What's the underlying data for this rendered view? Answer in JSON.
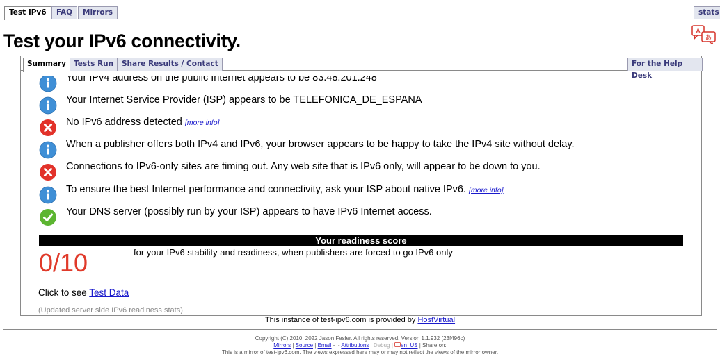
{
  "top_tabs": {
    "test": "Test IPv6",
    "faq": "FAQ",
    "mirrors": "Mirrors",
    "stats": "stats"
  },
  "page_title": "Test your IPv6 connectivity.",
  "inner_tabs": {
    "summary": "Summary",
    "tests_run": "Tests Run",
    "share": "Share Results / Contact",
    "help_desk": "For the Help Desk"
  },
  "results": [
    {
      "status": "info",
      "text": "Your IPv4 address on the public Internet appears to be 83.48.201.248",
      "more": ""
    },
    {
      "status": "info",
      "text": "Your Internet Service Provider (ISP) appears to be TELEFONICA_DE_ESPANA",
      "more": ""
    },
    {
      "status": "error",
      "text": "No IPv6 address detected",
      "more": "[more info]"
    },
    {
      "status": "info",
      "text": "When a publisher offers both IPv4 and IPv6, your browser appears to be happy to take the IPv4 site without delay.",
      "more": ""
    },
    {
      "status": "error",
      "text": "Connections to IPv6-only sites are timing out. Any web site that is IPv6 only, will appear to be down to you.",
      "more": ""
    },
    {
      "status": "info",
      "text": "To ensure the best Internet performance and connectivity, ask your ISP about native IPv6.",
      "more": "[more info]"
    },
    {
      "status": "ok",
      "text": "Your DNS server (possibly run by your ISP) appears to have IPv6 Internet access.",
      "more": ""
    }
  ],
  "readiness": {
    "header": "Your readiness score",
    "score": "0/10",
    "description": "for your IPv6 stability and readiness, when publishers are forced to go IPv6 only"
  },
  "click_to_see": {
    "prefix": "Click to see ",
    "link": "Test Data"
  },
  "updated_note": "(Updated server side IPv6 readiness stats)",
  "provided_by": {
    "prefix": "This instance of test-ipv6.com is provided by ",
    "link": "HostVirtual"
  },
  "footer": {
    "copyright": "Copyright (C) 2010, 2022 Jason Fesler. All rights reserved. Version 1.1.932 (23f496c)",
    "mirrors": "Mirrors",
    "source": "Source",
    "email": "Email",
    "attributions": "Attributions",
    "debug": "Debug",
    "locale": "en_US",
    "share_on": "Share on:",
    "mirror_note": "This is a mirror of test-ipv6.com. The views expressed here may or may not reflect the views of the mirror owner."
  },
  "colors": {
    "info": "#3f8fd6",
    "error": "#e2322a",
    "ok": "#5cb531",
    "score": "#e03a2a"
  }
}
